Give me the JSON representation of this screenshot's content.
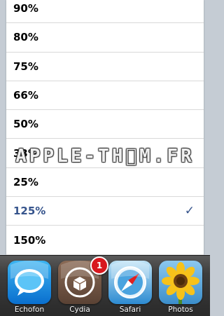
{
  "list": {
    "items": [
      {
        "label": "90%",
        "selected": false
      },
      {
        "label": "80%",
        "selected": false
      },
      {
        "label": "75%",
        "selected": false
      },
      {
        "label": "66%",
        "selected": false
      },
      {
        "label": "50%",
        "selected": false
      },
      {
        "label": "33%",
        "selected": false
      },
      {
        "label": "25%",
        "selected": false
      },
      {
        "label": "125%",
        "selected": true
      },
      {
        "label": "150%",
        "selected": false
      }
    ],
    "checkmark": "✓",
    "selected_color": "#36548c"
  },
  "watermark": {
    "text": "APPLE-THM.FR"
  },
  "dock": {
    "apps": [
      {
        "label": "Echofon",
        "icon": "echofon-speech-bubble-icon"
      },
      {
        "label": "Cydia",
        "icon": "cydia-box-icon",
        "badge": "1"
      },
      {
        "label": "Safari",
        "icon": "safari-compass-icon"
      },
      {
        "label": "Photos",
        "icon": "sunflower-icon"
      }
    ]
  }
}
